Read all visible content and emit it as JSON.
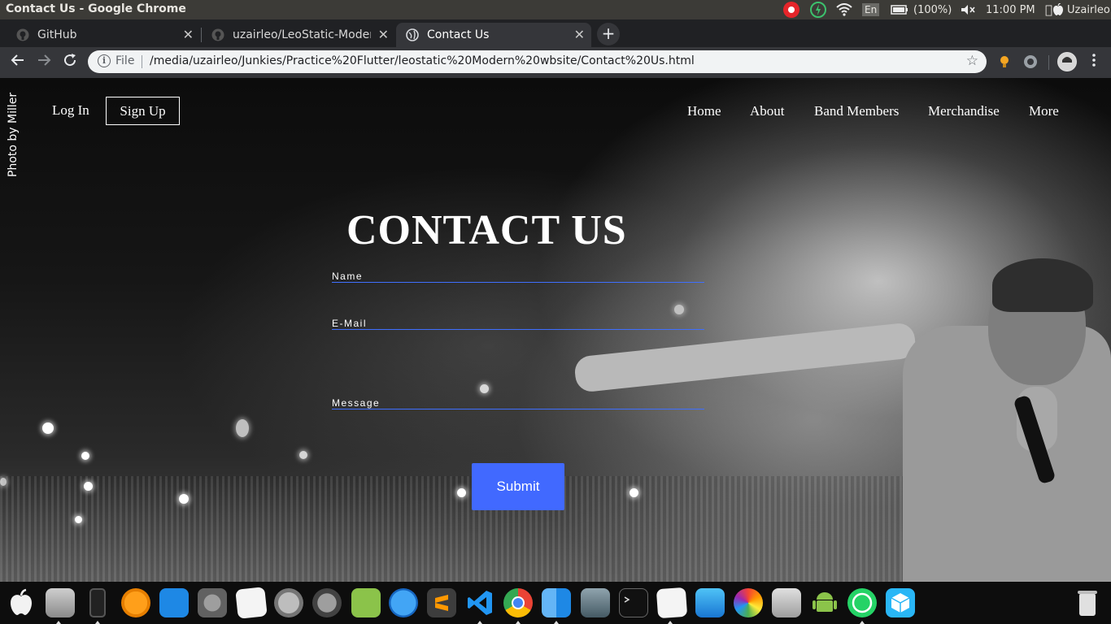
{
  "os": {
    "window_title": "Contact Us - Google Chrome",
    "keyboard": "En",
    "battery": "(100%)",
    "time": "11:00 PM",
    "user": "Uzairleo"
  },
  "browser": {
    "tabs": [
      {
        "label": "GitHub",
        "icon": "github-icon"
      },
      {
        "label": "uzairleo/LeoStatic-Modern",
        "icon": "github-icon"
      },
      {
        "label": "Contact Us",
        "icon": "globe-icon"
      }
    ],
    "new_tab": "+",
    "omnibox": {
      "scheme_label": "File",
      "url": "/media/uzairleo/Junkies/Practice%20Flutter/leostatic%20Modern%20wbsite/Contact%20Us.html"
    }
  },
  "page": {
    "photo_credit": "Photo by Miller",
    "login": "Log In",
    "signup": "Sign Up",
    "nav": [
      "Home",
      "About",
      "Band Members",
      "Merchandise",
      "More"
    ],
    "title": "CONTACT US",
    "form": {
      "name_label": "Name",
      "email_label": "E-Mail",
      "message_label": "Message",
      "submit": "Submit"
    },
    "colors": {
      "accent": "#4169ff",
      "field_underline": "#3f6fff"
    }
  },
  "dock": {
    "apps": [
      "apple-icon",
      "finder-drive-icon",
      "phone-icon",
      "vlc-icon",
      "mail-icon",
      "settings-icon",
      "notes-icon",
      "launchpad-icon",
      "tools-icon",
      "ebook-icon",
      "app-store-icon",
      "sublime-icon",
      "vscode-icon",
      "chrome-icon",
      "finder-icon",
      "photos-preview-icon",
      "terminal-icon",
      "text-editor-icon",
      "files-icon",
      "photos-icon",
      "calculator-icon",
      "android-icon",
      "whatsapp-icon",
      "box-icon",
      "trash-icon"
    ]
  }
}
